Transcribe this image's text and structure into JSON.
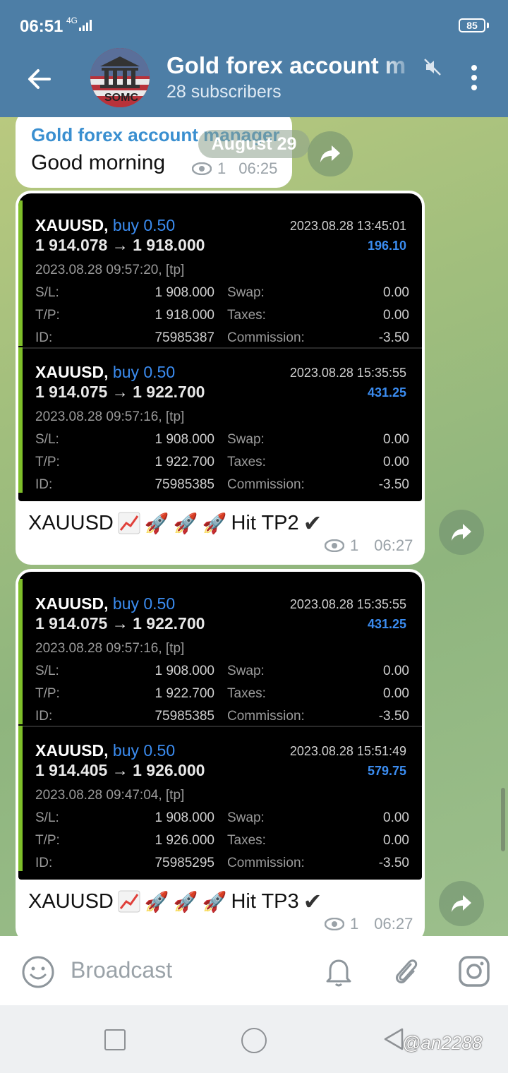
{
  "status_bar": {
    "time": "06:51",
    "network": "4G",
    "battery": "85"
  },
  "header": {
    "channel_name": "Gold forex account m",
    "subscribers": "28 subscribers",
    "avatar_text": "SOMC"
  },
  "date_pill": "August 29",
  "messages": [
    {
      "sender": "Gold forex account manager",
      "text": "Good morning",
      "views": "1",
      "time": "06:25"
    },
    {
      "trades": [
        {
          "symbol": "XAUUSD,",
          "side": "buy 0.50",
          "prices": "1 914.078 → 1 918.000",
          "close_time": "2023.08.28 13:45:01",
          "profit": "196.10",
          "open_time": "2023.08.28 09:57:20, [tp]",
          "sl": "1 908.000",
          "tp": "1 918.000",
          "id": "75985387",
          "swap": "0.00",
          "taxes": "0.00",
          "commission": "-3.50"
        },
        {
          "symbol": "XAUUSD,",
          "side": "buy 0.50",
          "prices": "1 914.075 → 1 922.700",
          "close_time": "2023.08.28 15:35:55",
          "profit": "431.25",
          "open_time": "2023.08.28 09:57:16, [tp]",
          "sl": "1 908.000",
          "tp": "1 922.700",
          "id": "75985385",
          "swap": "0.00",
          "taxes": "0.00",
          "commission": "-3.50"
        }
      ],
      "caption": {
        "prefix": "XAUUSD",
        "text": "Hit TP2"
      },
      "views": "1",
      "time": "06:27"
    },
    {
      "trades": [
        {
          "symbol": "XAUUSD,",
          "side": "buy 0.50",
          "prices": "1 914.075 → 1 922.700",
          "close_time": "2023.08.28 15:35:55",
          "profit": "431.25",
          "open_time": "2023.08.28 09:57:16, [tp]",
          "sl": "1 908.000",
          "tp": "1 922.700",
          "id": "75985385",
          "swap": "0.00",
          "taxes": "0.00",
          "commission": "-3.50"
        },
        {
          "symbol": "XAUUSD,",
          "side": "buy 0.50",
          "prices": "1 914.405 → 1 926.000",
          "close_time": "2023.08.28 15:51:49",
          "profit": "579.75",
          "open_time": "2023.08.28 09:47:04, [tp]",
          "sl": "1 908.000",
          "tp": "1 926.000",
          "id": "75985295",
          "swap": "0.00",
          "taxes": "0.00",
          "commission": "-3.50"
        }
      ],
      "caption": {
        "prefix": "XAUUSD",
        "text": "Hit TP3"
      },
      "views": "1",
      "time": "06:27"
    }
  ],
  "labels": {
    "sl": "S/L:",
    "tp": "T/P:",
    "id": "ID:",
    "swap": "Swap:",
    "taxes": "Taxes:",
    "commission": "Commission:"
  },
  "input": {
    "placeholder": "Broadcast"
  },
  "watermark": "@an2288",
  "colors": {
    "header": "#4d7ea6",
    "accent": "#3a8fd0",
    "trade_stripe": "#7fbf2a",
    "buy_blue": "#3b8cf0"
  }
}
